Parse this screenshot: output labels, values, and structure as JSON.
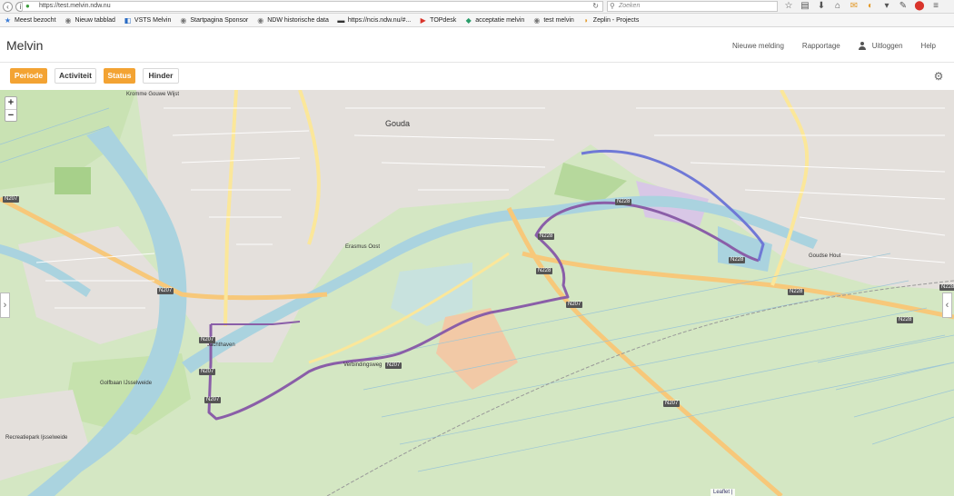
{
  "browser": {
    "url": "https://test.melvin.ndw.nu",
    "search_placeholder": "Zoeken",
    "bookmarks": [
      {
        "label": "Meest bezocht",
        "icon": "star-icon"
      },
      {
        "label": "Nieuw tabblad",
        "icon": "globe-icon"
      },
      {
        "label": "VSTS Melvin",
        "icon": "vs-icon"
      },
      {
        "label": "Startpagina Sponsor",
        "icon": "globe-icon"
      },
      {
        "label": "NDW historische data",
        "icon": "globe-icon"
      },
      {
        "label": "https://ncis.ndw.nu/#...",
        "icon": "ncis-icon"
      },
      {
        "label": "TOPdesk",
        "icon": "topdesk-icon"
      },
      {
        "label": "acceptatie melvin",
        "icon": "melvin-icon"
      },
      {
        "label": "test melvin",
        "icon": "globe-icon"
      },
      {
        "label": "Zeplin - Projects",
        "icon": "zeplin-icon"
      }
    ]
  },
  "app": {
    "title": "Melvin",
    "nav": {
      "new_report": "Nieuwe melding",
      "reporting": "Rapportage",
      "logout": "Uitloggen",
      "help": "Help"
    }
  },
  "filters": [
    {
      "label": "Periode",
      "active": true
    },
    {
      "label": "Activiteit",
      "active": false
    },
    {
      "label": "Status",
      "active": true
    },
    {
      "label": "Hinder",
      "active": false
    }
  ],
  "map": {
    "zoom_in": "+",
    "zoom_out": "−",
    "attribution": "Leaflet |",
    "place_labels": {
      "gouda": "Gouda",
      "krommegouwe": "Kromme Gouwe Wijst",
      "verbindingsweg": "Verbindingsweg",
      "goudse_hout": "Goudse Hout",
      "golfbaan": "Golfbaan IJsselweide",
      "recreatiepark": "Recreatiepark Ijsselweide",
      "jachthaven": "Jachthaven",
      "erasmus": "Erasmus Oost"
    },
    "road_labels": {
      "n207": "N207",
      "n228": "N228"
    }
  },
  "colors": {
    "accent": "#f3a333",
    "route": "#8a5ea8",
    "route_blue": "#6f78d6"
  }
}
